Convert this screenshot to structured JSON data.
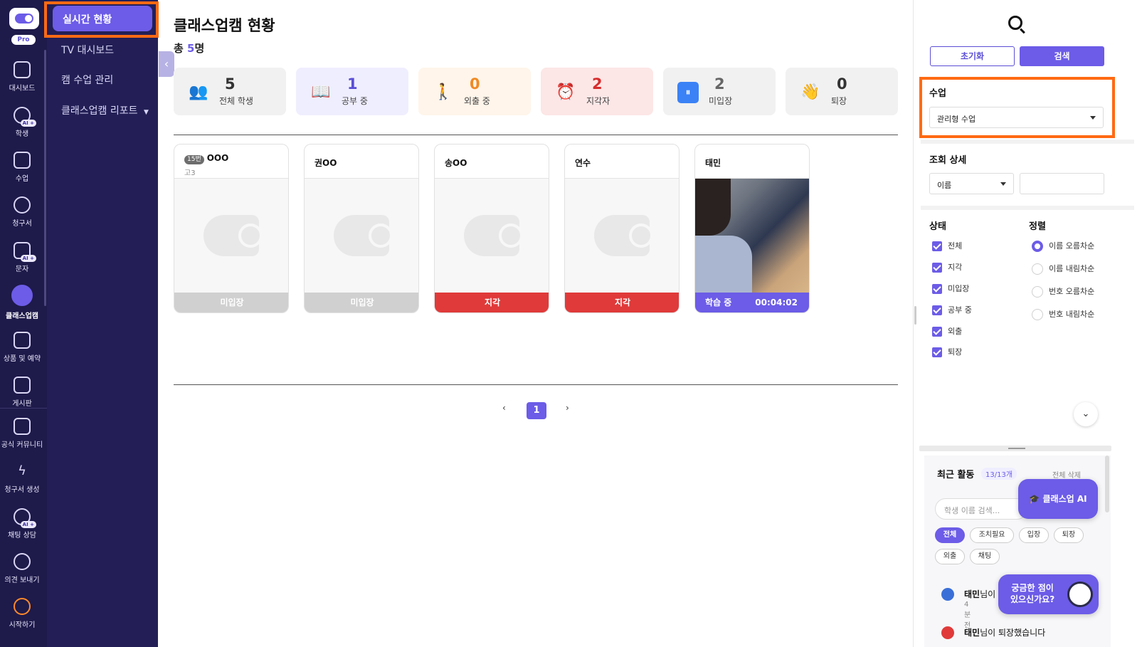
{
  "rail": {
    "pro": "Pro",
    "items": [
      {
        "label": "대시보드",
        "icon": "dashboard-grid-icon"
      },
      {
        "label": "학생",
        "icon": "students-icon",
        "ai": "AI +"
      },
      {
        "label": "수업",
        "icon": "calendar-icon"
      },
      {
        "label": "청구서",
        "icon": "won-icon"
      },
      {
        "label": "문자",
        "icon": "mail-icon",
        "ai": "AI +"
      },
      {
        "label": "클래스업캠",
        "icon": "webcam-icon"
      },
      {
        "label": "상품 및 예약",
        "icon": "bag-icon"
      },
      {
        "label": "게시판",
        "icon": "chat-bubble-icon"
      },
      {
        "label": "공식 커뮤니티",
        "icon": "community-icon"
      },
      {
        "label": "청구서 생성",
        "icon": "bolt-icon"
      },
      {
        "label": "채팅 상담",
        "icon": "chat-consult-icon",
        "ai": "AI +"
      },
      {
        "label": "의견 보내기",
        "icon": "feedback-icon"
      },
      {
        "label": "시작하기",
        "icon": "start-icon"
      }
    ]
  },
  "subnav": {
    "active": "실시간 현황",
    "items": [
      "TV 대시보드",
      "캠 수업 관리",
      "클래스업캠 리포트"
    ]
  },
  "main": {
    "title": "클래스업캠 현황",
    "total_prefix": "총 ",
    "total_num": "5",
    "total_suffix": "명",
    "stats": [
      {
        "value": "5",
        "label": "전체 학생",
        "icon": "people-icon",
        "bg": "#f1f1f1",
        "color": "#333333",
        "glyph": "👥"
      },
      {
        "value": "1",
        "label": "공부 중",
        "icon": "book-icon",
        "bg": "#efeefe",
        "color": "#5b4ed6",
        "glyph": "📖"
      },
      {
        "value": "0",
        "label": "외출 중",
        "icon": "walking-icon",
        "bg": "#fff5ea",
        "color": "#f08a24",
        "glyph": "🚶"
      },
      {
        "value": "2",
        "label": "지각자",
        "icon": "alarm-clock-icon",
        "bg": "#fde6e6",
        "color": "#d62d2d",
        "glyph": "⏰"
      },
      {
        "value": "2",
        "label": "미입장",
        "icon": "pause-icon",
        "bg": "#f1f1f1",
        "color": "#666666",
        "glyph": "⏸"
      },
      {
        "value": "0",
        "label": "퇴장",
        "icon": "waving-hand-icon",
        "bg": "#f1f1f1",
        "color": "#333333",
        "glyph": "👋"
      }
    ],
    "cards": [
      {
        "badge": "15번",
        "name": "OOO",
        "grade": "고3",
        "status": "미입장",
        "kind": "absent"
      },
      {
        "name": "권OO",
        "status": "미입장",
        "kind": "absent"
      },
      {
        "name": "송OO",
        "status": "지각",
        "kind": "late"
      },
      {
        "name": "연수",
        "status": "지각",
        "kind": "late"
      },
      {
        "name": "태민",
        "status": "학습 중",
        "time": "00:04:02",
        "kind": "study"
      }
    ],
    "pager": {
      "prev": "‹",
      "current": "1",
      "next": "›"
    }
  },
  "right": {
    "reset": "초기화",
    "search": "검색",
    "class_title": "수업",
    "class_value": "관리형 수업",
    "detail_title": "조회 상세",
    "detail_field": "이름",
    "status_title": "상태",
    "status_items": [
      "전체",
      "지각",
      "미입장",
      "공부 중",
      "외출",
      "퇴장"
    ],
    "sort_title": "정렬",
    "sort_items": [
      "이름 오름차순",
      "이름 내림차순",
      "번호 오름차순",
      "번호 내림차순"
    ],
    "activity": {
      "title": "최근 활동",
      "count": "13/13개",
      "clear": "전체 삭제",
      "search_placeholder": "학생 이름 검색...",
      "chips": [
        "전체",
        "조치필요",
        "입장",
        "퇴장",
        "외출",
        "채팅"
      ],
      "rows": [
        {
          "name": "태민",
          "text": "님이 ",
          "ago": "4분 전",
          "color": "#3a6fd8"
        },
        {
          "name": "태민",
          "text": "님이 퇴장했습니다",
          "ago": "",
          "color": "#e03a3a"
        }
      ]
    },
    "ai_button": "🎓 클래스업 AI",
    "help_line1": "궁금한 점이",
    "help_line2": "있으신가요?"
  }
}
